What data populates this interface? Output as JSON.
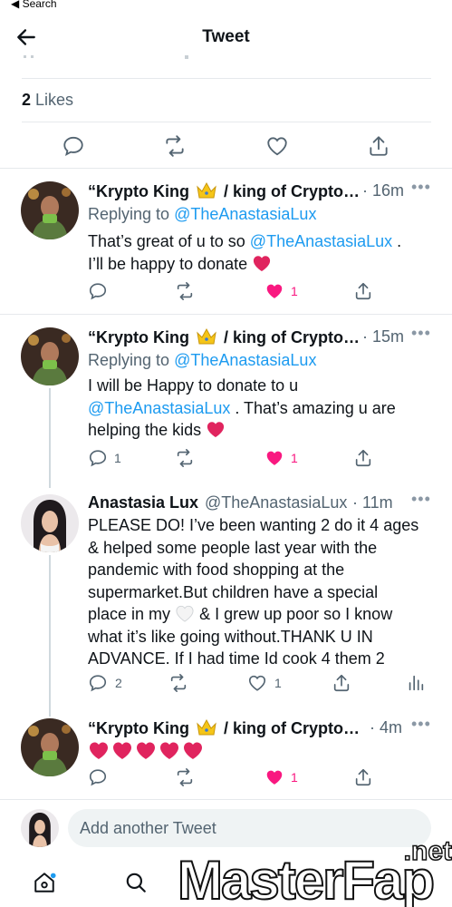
{
  "status_bar": {
    "back_label": "◀ Search"
  },
  "header": {
    "title": "Tweet",
    "back_icon": "arrow-left-icon"
  },
  "likes": {
    "count": "2",
    "label": "Likes"
  },
  "colors": {
    "accent": "#1d9bf0",
    "like": "#f91880",
    "text": "#0f1419",
    "muted": "#536471"
  },
  "tweets": [
    {
      "author": "“Krypto King",
      "author_suffix": "/ king of Crypto…",
      "time": "· 16m",
      "replying_prefix": "Replying to",
      "replying_handle": "@TheAnastasiaLux",
      "text_a": "That’s great of u to so",
      "mention": "@TheAnastasiaLux",
      "text_b": ".",
      "text_c": "I’ll be happy to donate",
      "reply_count": "",
      "retweet_count": "",
      "like_count": "1"
    },
    {
      "author": "“Krypto King",
      "author_suffix": "/ king of Crypto…",
      "time": "· 15m",
      "replying_prefix": "Replying to",
      "replying_handle": "@TheAnastasiaLux",
      "text_a": "I will be Happy to donate to u",
      "mention": "@TheAnastasiaLux",
      "text_b": ".  That’s amazing u are",
      "text_c": "helping the kids",
      "reply_count": "1",
      "retweet_count": "",
      "like_count": "1"
    },
    {
      "author": "Anastasia Lux",
      "handle": "@TheAnastasiaLux",
      "time": "· 11m",
      "line_1": "PLEASE DO! I’ve been wanting 2 do it 4 ages",
      "line_2": "& helped some people last year with the",
      "line_3": "pandemic with food shopping at the",
      "line_4": "supermarket.But children have a special",
      "line_5a": "place in my",
      "line_5b": "& I grew up poor so I know",
      "line_6": "what it’s like going without.THANK U IN",
      "line_7": "ADVANCE. If I had time Id cook 4 them 2",
      "reply_count": "2",
      "retweet_count": "",
      "like_count": "1"
    },
    {
      "author": "“Krypto King",
      "author_suffix": "/ king of Crypto…",
      "time": "· 4m",
      "reply_count": "",
      "retweet_count": "",
      "like_count": "1"
    }
  ],
  "compose": {
    "placeholder": "Add another Tweet"
  },
  "tabbar": {
    "items": [
      "home-icon",
      "search-icon"
    ]
  },
  "watermark": {
    "site": "MasterFap",
    "tld": ".net"
  }
}
